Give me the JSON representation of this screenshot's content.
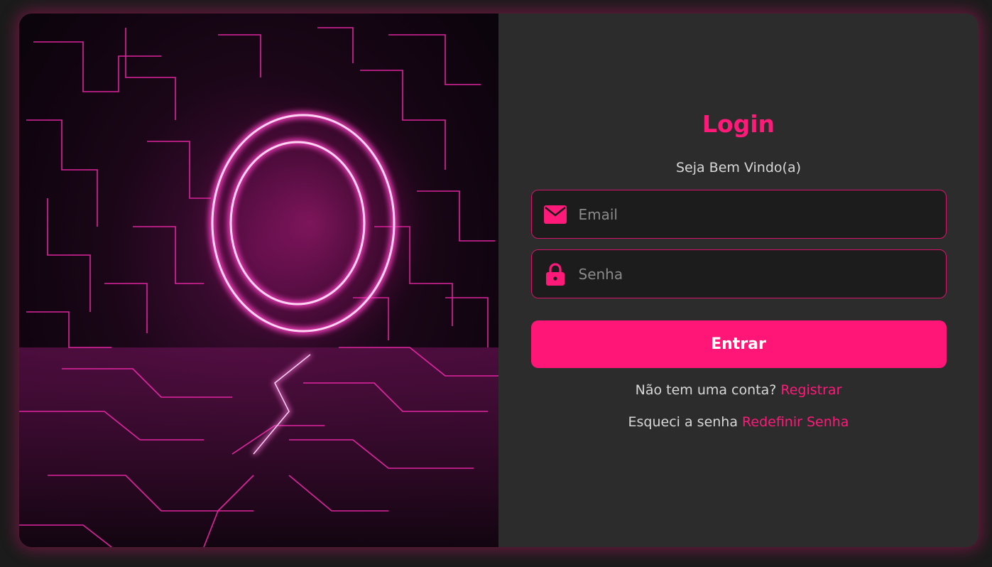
{
  "login": {
    "title": "Login",
    "subtitle": "Seja Bem Vindo(a)",
    "email_placeholder": "Email",
    "password_placeholder": "Senha",
    "submit_label": "Entrar",
    "register_prompt": "Não tem uma conta?",
    "register_link": "Registrar",
    "forgot_prompt": "Esqueci a senha",
    "forgot_link": "Redefinir Senha"
  },
  "icons": {
    "email": "envelope-icon",
    "password": "lock-icon"
  },
  "colors": {
    "accent": "#ff1676",
    "panel": "#2c2c2c",
    "page": "#1b1b1b"
  }
}
